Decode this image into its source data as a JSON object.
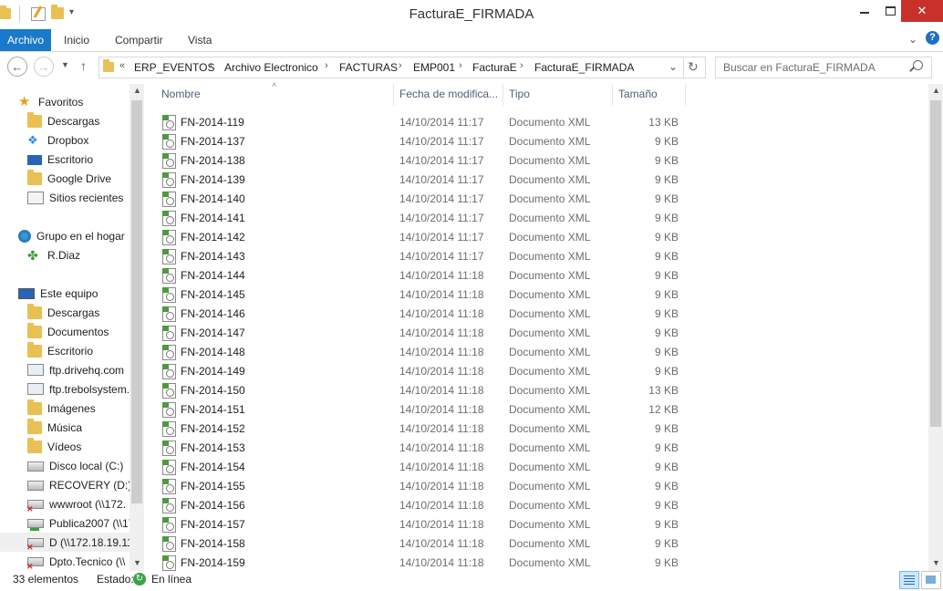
{
  "window": {
    "title": "FacturaE_FIRMADA"
  },
  "ribbon": {
    "tabs": [
      {
        "label": "Archivo"
      },
      {
        "label": "Inicio"
      },
      {
        "label": "Compartir"
      },
      {
        "label": "Vista"
      }
    ]
  },
  "address": {
    "overflow": "«",
    "crumbs": [
      "ERP_EVENTOS",
      "Archivo Electronico",
      "FACTURAS",
      "EMP001",
      "FacturaE",
      "FacturaE_FIRMADA"
    ]
  },
  "search": {
    "placeholder": "Buscar en FacturaE_FIRMADA"
  },
  "nav": {
    "favorites": {
      "label": "Favoritos",
      "items": [
        "Descargas",
        "Dropbox",
        "Escritorio",
        "Google Drive",
        "Sitios recientes"
      ]
    },
    "homegroup": {
      "label": "Grupo en el hogar",
      "items": [
        "R.Diaz"
      ]
    },
    "computer": {
      "label": "Este equipo",
      "items": [
        "Descargas",
        "Documentos",
        "Escritorio",
        "ftp.drivehq.com",
        "ftp.trebolsystem.",
        "Imágenes",
        "Música",
        "Vídeos",
        "Disco local (C:)",
        "RECOVERY (D:)",
        "wwwroot (\\\\172.",
        "Publica2007 (\\\\17",
        "D (\\\\172.18.19.11",
        "Dpto.Tecnico (\\\\"
      ]
    }
  },
  "columns": {
    "name": "Nombre",
    "date": "Fecha de modifica...",
    "type": "Tipo",
    "size": "Tamaño"
  },
  "files": [
    {
      "name": "FN-2014-119",
      "date": "14/10/2014 11:17",
      "type": "Documento XML",
      "size": "13 KB"
    },
    {
      "name": "FN-2014-137",
      "date": "14/10/2014 11:17",
      "type": "Documento XML",
      "size": "9 KB"
    },
    {
      "name": "FN-2014-138",
      "date": "14/10/2014 11:17",
      "type": "Documento XML",
      "size": "9 KB"
    },
    {
      "name": "FN-2014-139",
      "date": "14/10/2014 11:17",
      "type": "Documento XML",
      "size": "9 KB"
    },
    {
      "name": "FN-2014-140",
      "date": "14/10/2014 11:17",
      "type": "Documento XML",
      "size": "9 KB"
    },
    {
      "name": "FN-2014-141",
      "date": "14/10/2014 11:17",
      "type": "Documento XML",
      "size": "9 KB"
    },
    {
      "name": "FN-2014-142",
      "date": "14/10/2014 11:17",
      "type": "Documento XML",
      "size": "9 KB"
    },
    {
      "name": "FN-2014-143",
      "date": "14/10/2014 11:17",
      "type": "Documento XML",
      "size": "9 KB"
    },
    {
      "name": "FN-2014-144",
      "date": "14/10/2014 11:18",
      "type": "Documento XML",
      "size": "9 KB"
    },
    {
      "name": "FN-2014-145",
      "date": "14/10/2014 11:18",
      "type": "Documento XML",
      "size": "9 KB"
    },
    {
      "name": "FN-2014-146",
      "date": "14/10/2014 11:18",
      "type": "Documento XML",
      "size": "9 KB"
    },
    {
      "name": "FN-2014-147",
      "date": "14/10/2014 11:18",
      "type": "Documento XML",
      "size": "9 KB"
    },
    {
      "name": "FN-2014-148",
      "date": "14/10/2014 11:18",
      "type": "Documento XML",
      "size": "9 KB"
    },
    {
      "name": "FN-2014-149",
      "date": "14/10/2014 11:18",
      "type": "Documento XML",
      "size": "9 KB"
    },
    {
      "name": "FN-2014-150",
      "date": "14/10/2014 11:18",
      "type": "Documento XML",
      "size": "13 KB"
    },
    {
      "name": "FN-2014-151",
      "date": "14/10/2014 11:18",
      "type": "Documento XML",
      "size": "12 KB"
    },
    {
      "name": "FN-2014-152",
      "date": "14/10/2014 11:18",
      "type": "Documento XML",
      "size": "9 KB"
    },
    {
      "name": "FN-2014-153",
      "date": "14/10/2014 11:18",
      "type": "Documento XML",
      "size": "9 KB"
    },
    {
      "name": "FN-2014-154",
      "date": "14/10/2014 11:18",
      "type": "Documento XML",
      "size": "9 KB"
    },
    {
      "name": "FN-2014-155",
      "date": "14/10/2014 11:18",
      "type": "Documento XML",
      "size": "9 KB"
    },
    {
      "name": "FN-2014-156",
      "date": "14/10/2014 11:18",
      "type": "Documento XML",
      "size": "9 KB"
    },
    {
      "name": "FN-2014-157",
      "date": "14/10/2014 11:18",
      "type": "Documento XML",
      "size": "9 KB"
    },
    {
      "name": "FN-2014-158",
      "date": "14/10/2014 11:18",
      "type": "Documento XML",
      "size": "9 KB"
    },
    {
      "name": "FN-2014-159",
      "date": "14/10/2014 11:18",
      "type": "Documento XML",
      "size": "9 KB"
    }
  ],
  "status": {
    "count": "33 elementos",
    "state_label": "Estado:",
    "state_value": "En línea"
  }
}
